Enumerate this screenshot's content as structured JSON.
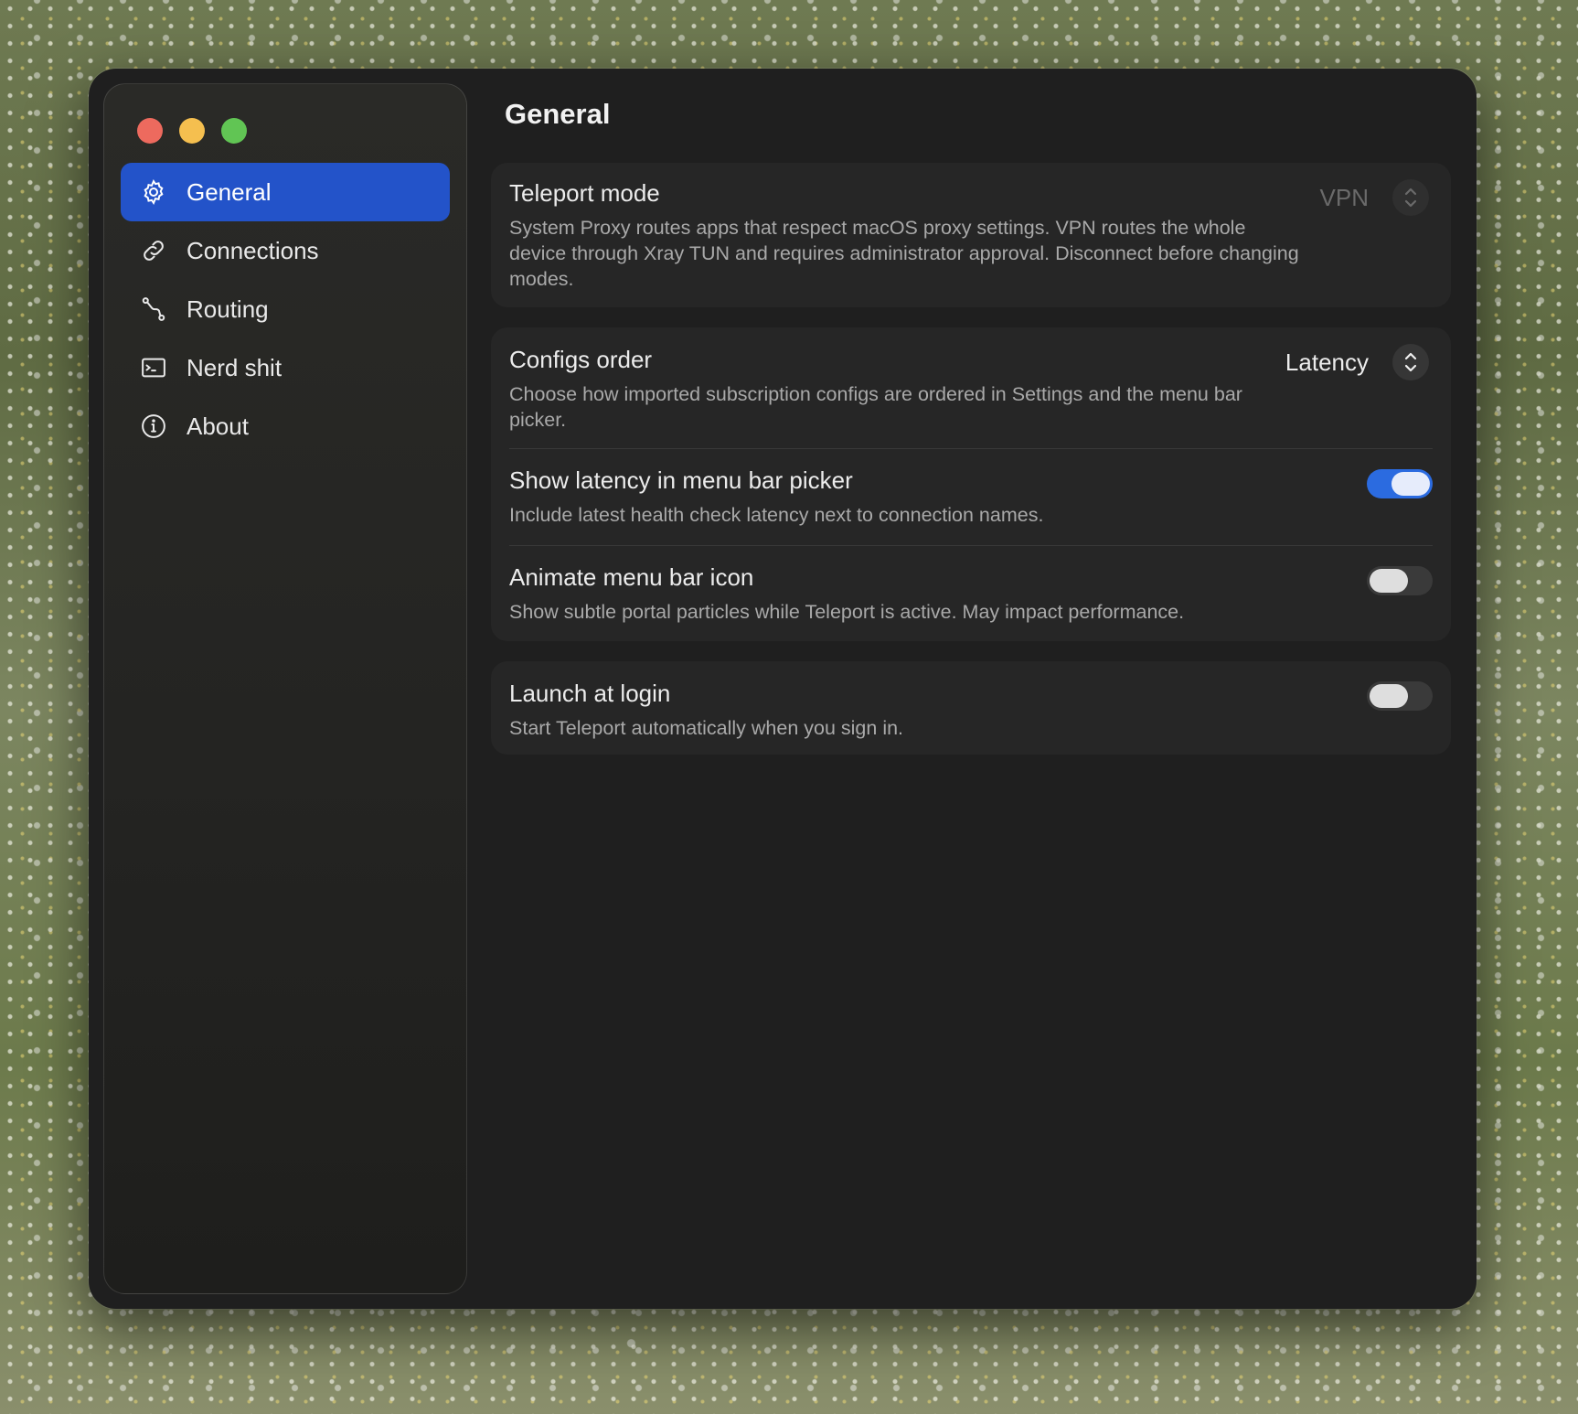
{
  "window": {
    "traffic_lights": [
      "close",
      "minimize",
      "zoom"
    ]
  },
  "sidebar": {
    "items": [
      {
        "label": "General",
        "icon": "gear-icon",
        "active": true
      },
      {
        "label": "Connections",
        "icon": "link-icon",
        "active": false
      },
      {
        "label": "Routing",
        "icon": "route-icon",
        "active": false
      },
      {
        "label": "Nerd shit",
        "icon": "terminal-icon",
        "active": false
      },
      {
        "label": "About",
        "icon": "info-icon",
        "active": false
      }
    ]
  },
  "main": {
    "title": "General",
    "teleport_mode": {
      "title": "Teleport mode",
      "description": "System Proxy routes apps that respect macOS proxy settings. VPN routes the whole device through Xray TUN and requires administrator approval. Disconnect before changing modes.",
      "value": "VPN",
      "disabled": true
    },
    "configs_order": {
      "title": "Configs order",
      "description": "Choose how imported subscription configs are ordered in Settings and the menu bar picker.",
      "value": "Latency"
    },
    "show_latency": {
      "title": "Show latency in menu bar picker",
      "description": "Include latest health check latency next to connection names.",
      "enabled": true
    },
    "animate_icon": {
      "title": "Animate menu bar icon",
      "description": "Show subtle portal particles while Teleport is active. May impact performance.",
      "enabled": false
    },
    "launch_at_login": {
      "title": "Launch at login",
      "description": "Start Teleport automatically when you sign in.",
      "enabled": false
    }
  },
  "colors": {
    "accent": "#2353c9",
    "toggle_on": "#2b6be0",
    "window_bg": "#1f1f1f",
    "card_bg": "#262626"
  }
}
